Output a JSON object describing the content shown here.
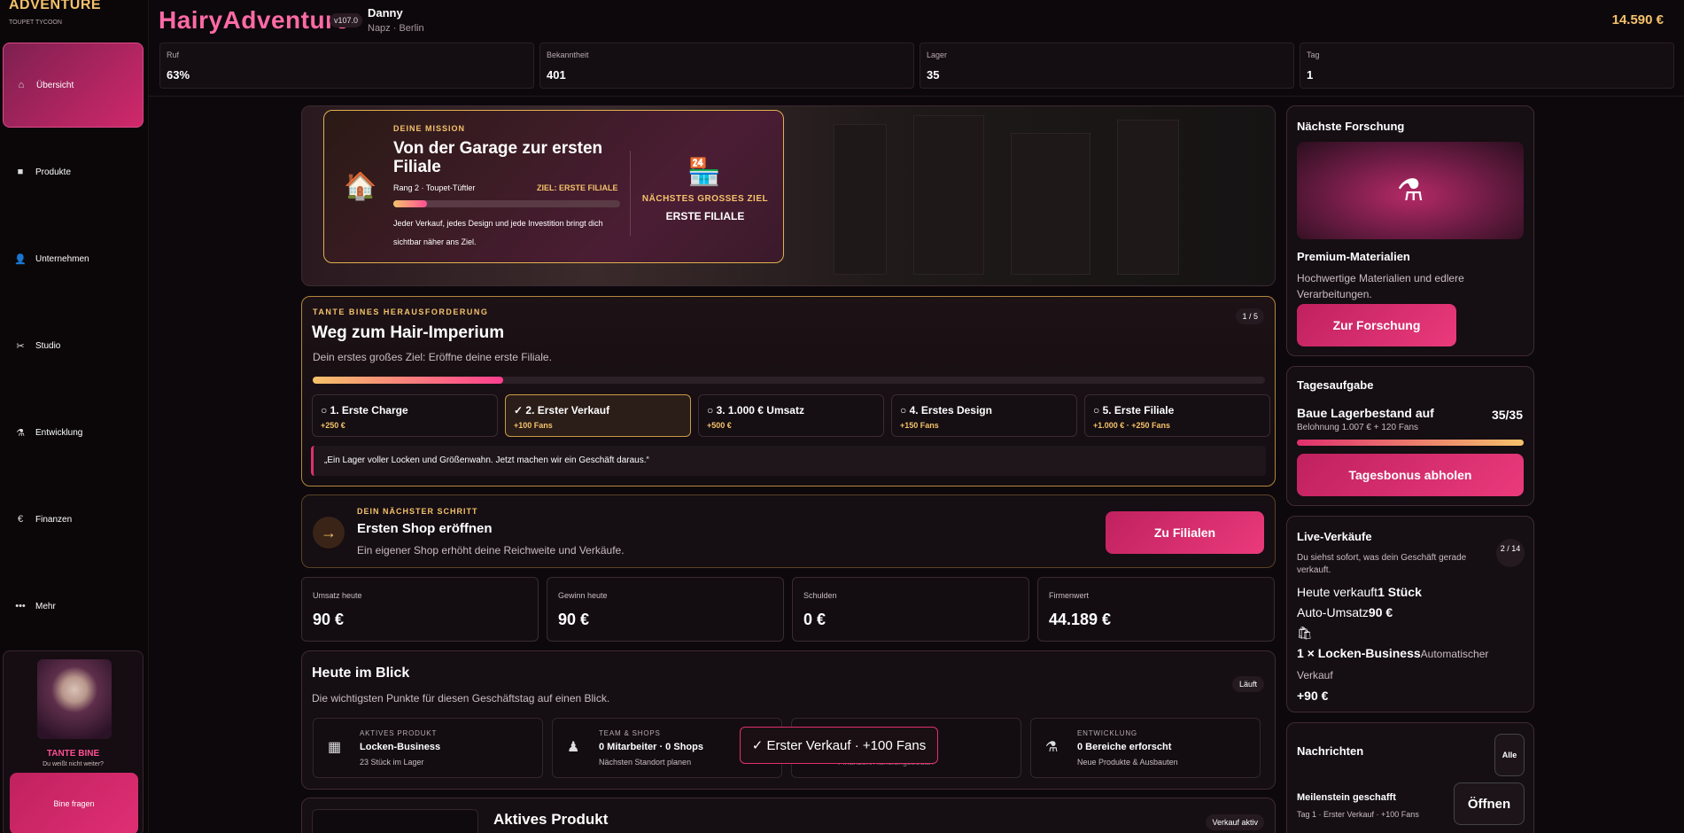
{
  "brand": {
    "title": "ADVENTURE",
    "subtitle": "TOUPET TYCOON"
  },
  "nav": [
    {
      "label": "Übersicht",
      "icon": "home-icon",
      "glyph": "⌂"
    },
    {
      "label": "Produkte",
      "icon": "box-icon",
      "glyph": "■"
    },
    {
      "label": "Unternehmen",
      "icon": "person-icon",
      "glyph": "👤"
    },
    {
      "label": "Studio",
      "icon": "scissors-icon",
      "glyph": "✂"
    },
    {
      "label": "Entwicklung",
      "icon": "research-icon",
      "glyph": "⚗"
    },
    {
      "label": "Finanzen",
      "icon": "euro-icon",
      "glyph": "€"
    },
    {
      "label": "Mehr",
      "icon": "more-icon",
      "glyph": "•••"
    }
  ],
  "bine": {
    "name": "TANTE BINE",
    "sub": "Du weißt nicht weiter?",
    "ask": "Bine fragen"
  },
  "header": {
    "logo": "HairyAdventure",
    "version": "v107.0",
    "user": "Danny",
    "location": "Napz · Berlin",
    "money": "14.590 €"
  },
  "stats": [
    {
      "label": "Ruf",
      "value": "63%"
    },
    {
      "label": "Bekanntheit",
      "value": "401"
    },
    {
      "label": "Lager",
      "value": "35"
    },
    {
      "label": "Tag",
      "value": "1"
    }
  ],
  "mission": {
    "label": "DEINE MISSION",
    "title": "Von der Garage zur ersten Filiale",
    "rank": "Rang 2 · Toupet-Tüftler",
    "goal": "ZIEL: ERSTE FILIALE",
    "progress": 0.15,
    "text": "Jeder Verkauf, jedes Design und jede Investition bringt dich sichtbar näher ans Ziel.",
    "next_label": "NÄCHSTES GROSSES ZIEL",
    "next_value": "ERSTE FILIALE"
  },
  "challenge": {
    "label": "TANTE BINES HERAUSFORDERUNG",
    "title": "Weg zum Hair-Imperium",
    "subtitle": "Dein erstes großes Ziel: Eröffne deine erste Filiale.",
    "count": "1 / 5",
    "progress": 0.2,
    "steps": [
      {
        "title": "○ 1. Erste Charge",
        "reward": "+250 €",
        "done": false
      },
      {
        "title": "✓ 2. Erster Verkauf",
        "reward": "+100 Fans",
        "done": true
      },
      {
        "title": "○ 3. 1.000 € Umsatz",
        "reward": "+500 €",
        "done": false
      },
      {
        "title": "○ 4. Erstes Design",
        "reward": "+150 Fans",
        "done": false
      },
      {
        "title": "○ 5. Erste Filiale",
        "reward": "+1.000 € · +250 Fans",
        "done": false
      }
    ],
    "quote": "„Ein Lager voller Locken und Größenwahn. Jetzt machen wir ein Geschäft daraus.“"
  },
  "next_step": {
    "label": "DEIN NÄCHSTER SCHRITT",
    "title": "Ersten Shop eröffnen",
    "subtitle": "Ein eigener Shop erhöht deine Reichweite und Verkäufe.",
    "button": "Zu Filialen",
    "arrow": "→"
  },
  "kpis": [
    {
      "label": "Umsatz heute",
      "value": "90 €"
    },
    {
      "label": "Gewinn heute",
      "value": "90 €"
    },
    {
      "label": "Schulden",
      "value": "0 €"
    },
    {
      "label": "Firmenwert",
      "value": "44.189 €"
    }
  ],
  "today": {
    "title": "Heute im Blick",
    "subtitle": "Die wichtigsten Punkte für diesen Geschäftstag auf einen Blick.",
    "badge": "Läuft",
    "cards": [
      {
        "label": "AKTIVES PRODUKT",
        "value": "Locken-Business",
        "sub": "23 Stück im Lager",
        "glyph": "▦"
      },
      {
        "label": "TEAM & SHOPS",
        "value": "0 Mitarbeiter · 0 Shops",
        "sub": "Nächsten Standort planen",
        "glyph": "♟"
      },
      {
        "label": "",
        "value": "",
        "sub": "Finanzen/Handlungsbedarf",
        "glyph": ""
      },
      {
        "label": "ENTWICKLUNG",
        "value": "0 Bereiche erforscht",
        "sub": "Neue Produkte & Ausbauten",
        "glyph": "⚗"
      }
    ]
  },
  "toast": "✓ Erster Verkauf · +100 Fans",
  "active_product": {
    "title": "Aktives Produkt",
    "badge": "Verkauf aktiv"
  },
  "research": {
    "title": "Nächste Forschung",
    "name": "Premium-Materialien",
    "desc": "Hochwertige Materialien und edlere Verarbeitungen.",
    "button": "Zur Forschung",
    "glyph": "⚗"
  },
  "daily": {
    "title": "Tagesaufgabe",
    "task": "Baue Lagerbestand auf",
    "count": "35/35",
    "reward": "Belohnung 1.007 € + 120 Fans",
    "progress": 1.0,
    "button": "Tagesbonus abholen"
  },
  "live": {
    "title": "Live-Verkäufe",
    "desc": "Du siehst sofort, was dein Geschäft gerade verkauft.",
    "page": "2 / 14",
    "sold_label": "Heute verkauft",
    "sold_value": "1 Stück",
    "auto_label": "Auto-Umsatz",
    "auto_value": "90 €",
    "bag": "🛍",
    "item": "1 × Locken-Business",
    "item_type": "Automatischer Verkauf",
    "amount": "+90 €"
  },
  "messages": {
    "title": "Nachrichten",
    "all": "Alle",
    "item": "Meilenstein geschafft",
    "sub": "Tag 1 · Erster Verkauf · +100 Fans",
    "open": "Öffnen"
  }
}
